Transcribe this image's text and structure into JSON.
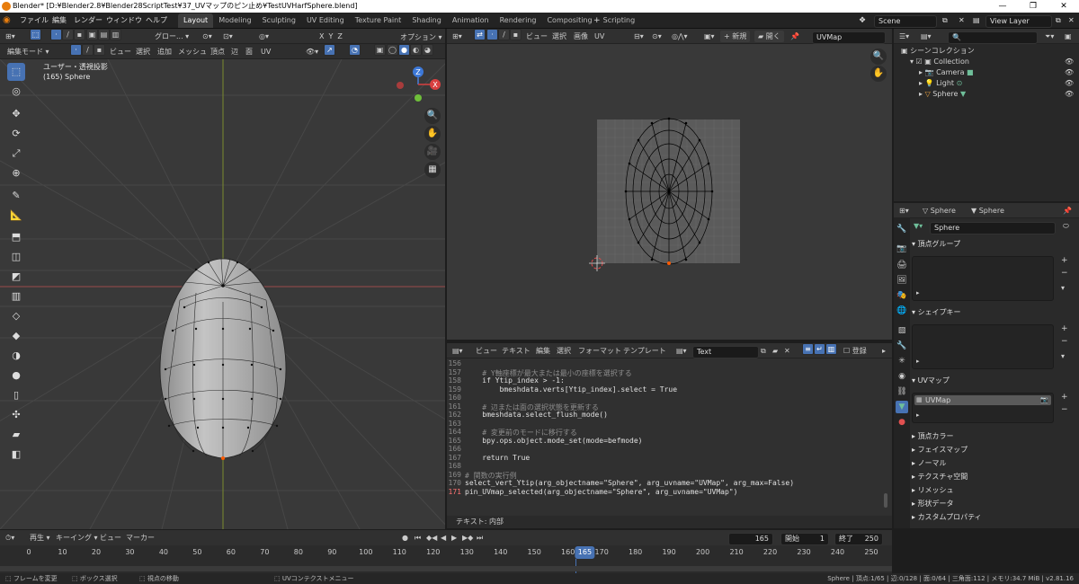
{
  "title_bar": {
    "title": "Blender* [D:¥Blender2.8¥Blender28ScriptTest¥37_UVマップのピン止め¥TestUVHarfSphere.blend]",
    "controls": [
      "—",
      "❐",
      "✕"
    ]
  },
  "top_menu": [
    "ファイル",
    "編集",
    "レンダー",
    "ウィンドウ",
    "ヘルプ"
  ],
  "workspace_tabs": [
    "Layout",
    "Modeling",
    "Sculpting",
    "UV Editing",
    "Texture Paint",
    "Shading",
    "Animation",
    "Rendering",
    "Compositing",
    "Scripting"
  ],
  "active_workspace": "Layout",
  "scene": {
    "label": "Scene",
    "view_layer": "View Layer"
  },
  "viewport3d": {
    "mode": "編集モード",
    "menus": [
      "ビュー",
      "選択",
      "追加",
      "メッシュ",
      "頂点",
      "辺",
      "面",
      "UV"
    ],
    "transform": "グロー...",
    "axes": [
      "X",
      "Y",
      "Z"
    ],
    "options": "オプション",
    "view_label": "ユーザー・透視投影",
    "object_label": "(165) Sphere",
    "gizmo": {
      "z": "Z",
      "x": "X"
    }
  },
  "uv_editor": {
    "menus": [
      "ビュー",
      "選択",
      "画像",
      "UV"
    ],
    "new_label": "新規",
    "open_label": "開く",
    "uvmap": "UVMap"
  },
  "text_editor": {
    "menus": [
      "ビュー",
      "テキスト",
      "編集",
      "選択",
      "フォーマット",
      "テンプレート"
    ],
    "text_name": "Text",
    "register_label": "登録",
    "status": "テキスト: 内部",
    "lines": [
      {
        "n": "156",
        "t": ""
      },
      {
        "n": "157",
        "t": "    # Y軸座標が最大または最小の座標を選択する"
      },
      {
        "n": "158",
        "t": "    if Ytip_index > -1:"
      },
      {
        "n": "159",
        "t": "        bmeshdata.verts[Ytip_index].select = True"
      },
      {
        "n": "160",
        "t": ""
      },
      {
        "n": "161",
        "t": "    # 辺または面の選択状態を更新する"
      },
      {
        "n": "162",
        "t": "    bmeshdata.select_flush_mode()"
      },
      {
        "n": "163",
        "t": ""
      },
      {
        "n": "164",
        "t": "    # 変更前のモードに移行する"
      },
      {
        "n": "165",
        "t": "    bpy.ops.object.mode_set(mode=befmode)"
      },
      {
        "n": "166",
        "t": ""
      },
      {
        "n": "167",
        "t": "    return True"
      },
      {
        "n": "168",
        "t": ""
      },
      {
        "n": "169",
        "t": "# 関数の実行例"
      },
      {
        "n": "170",
        "t": "select_vert_Ytip(arg_objectname=\"Sphere\", arg_uvname=\"UVMap\", arg_max=False)"
      },
      {
        "n": "171",
        "t": "pin_UVmap_selected(arg_objectname=\"Sphere\", arg_uvname=\"UVMap\")"
      }
    ]
  },
  "outliner": {
    "root": "シーンコレクション",
    "collection": "Collection",
    "items": [
      "Camera",
      "Light",
      "Sphere"
    ]
  },
  "properties": {
    "object": "Sphere",
    "mesh": "Sphere",
    "data_name": "Sphere",
    "panels_open": [
      "頂点グループ",
      "シェイプキー",
      "UVマップ"
    ],
    "uvmap_item": "UVMap",
    "panels_closed": [
      "頂点カラー",
      "フェイスマップ",
      "ノーマル",
      "テクスチャ空間",
      "リメッシュ",
      "形状データ",
      "カスタムプロパティ"
    ]
  },
  "timeline": {
    "menus": [
      "再生",
      "キーイング",
      "ビュー",
      "マーカー"
    ],
    "current_frame": "165",
    "start_label": "開始",
    "start": "1",
    "end_label": "終了",
    "end": "250",
    "ruler": [
      "0",
      "10",
      "20",
      "30",
      "40",
      "50",
      "60",
      "70",
      "80",
      "90",
      "100",
      "110",
      "120",
      "130",
      "140",
      "150",
      "160",
      "165",
      "170",
      "180",
      "190",
      "200",
      "210",
      "220",
      "230",
      "240",
      "250"
    ]
  },
  "statusbar": {
    "left": [
      "フレームを変更",
      "ボックス選択",
      "視点の移動",
      "UVコンテクストメニュー"
    ],
    "right": "Sphere | 頂点:1/65 | 辺:0/128 | 面:0/64 | 三角面:112 | メモリ:34.7 MiB | v2.81.16"
  },
  "colors": {
    "accent": "#4772b3",
    "orange": "#e87d0d",
    "selected_vertex": "#ff5a00"
  }
}
